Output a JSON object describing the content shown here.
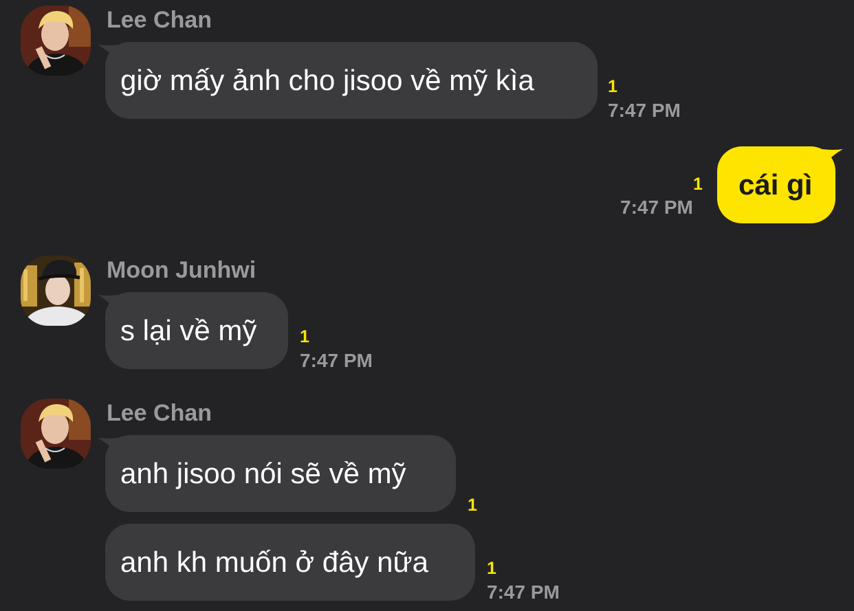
{
  "messages": [
    {
      "sender": "Lee Chan",
      "text": "giờ mấy ảnh cho jisoo về mỹ kìa",
      "unread": "1",
      "time": "7:47 PM"
    },
    {
      "sender": "",
      "text": "cái gì",
      "unread": "1",
      "time": "7:47 PM"
    },
    {
      "sender": "Moon Junhwi",
      "text": "s lại về mỹ",
      "unread": "1",
      "time": "7:47 PM"
    },
    {
      "sender": "Lee Chan",
      "text": "anh jisoo nói sẽ về mỹ",
      "unread": "1",
      "time": ""
    },
    {
      "sender": "",
      "text": "anh kh muốn ở đây nữa",
      "unread": "1",
      "time": "7:47 PM"
    }
  ],
  "colors": {
    "background": "#232325",
    "incoming_bubble": "#3b3b3e",
    "outgoing_bubble": "#fee500",
    "unread_count": "#fee500",
    "meta_text": "#9a9a9e"
  },
  "icons": {
    "lee_chan_avatar": "profile-photo-blond-hair",
    "moon_junhwi_avatar": "profile-photo-black-cap"
  }
}
